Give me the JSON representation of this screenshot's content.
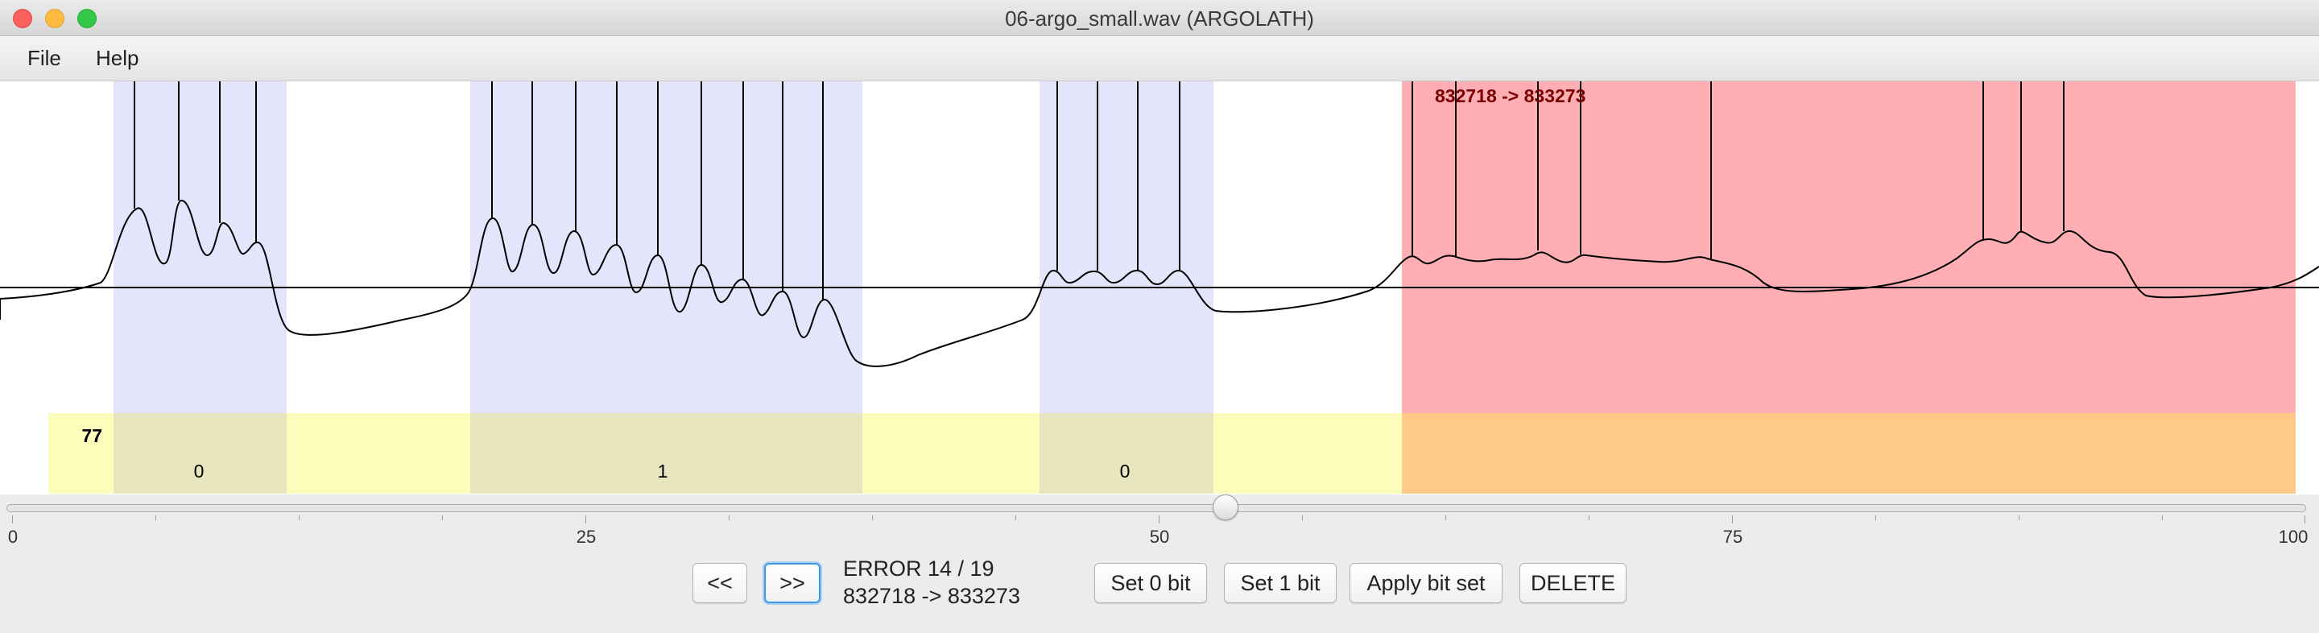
{
  "window": {
    "title": "06-argo_small.wav (ARGOLATH)"
  },
  "menu": {
    "file": "File",
    "help": "Help"
  },
  "waveform": {
    "segments": [
      {
        "kind": "bit",
        "bit_label": "0"
      },
      {
        "kind": "bit",
        "bit_label": "1"
      },
      {
        "kind": "bit",
        "bit_label": "0"
      },
      {
        "kind": "error",
        "range_label": "832718 -> 833273"
      }
    ],
    "byte_value": "77",
    "colors": {
      "bit_region": "#e4e5fa",
      "error_region": "#ffafb3",
      "byte_band": "#fdfdbb",
      "byte_band_bit": "#e7e6bf",
      "byte_band_error": "#ffc987"
    }
  },
  "slider": {
    "value": 53,
    "min": 0,
    "max": 100,
    "labels": [
      "0",
      "25",
      "50",
      "75",
      "100"
    ]
  },
  "controls": {
    "prev": "<<",
    "next": ">>",
    "error_status": "ERROR 14 / 19",
    "error_range": "832718 -> 833273",
    "set0": "Set 0 bit",
    "set1": "Set 1 bit",
    "apply": "Apply bit set",
    "delete": "DELETE"
  }
}
